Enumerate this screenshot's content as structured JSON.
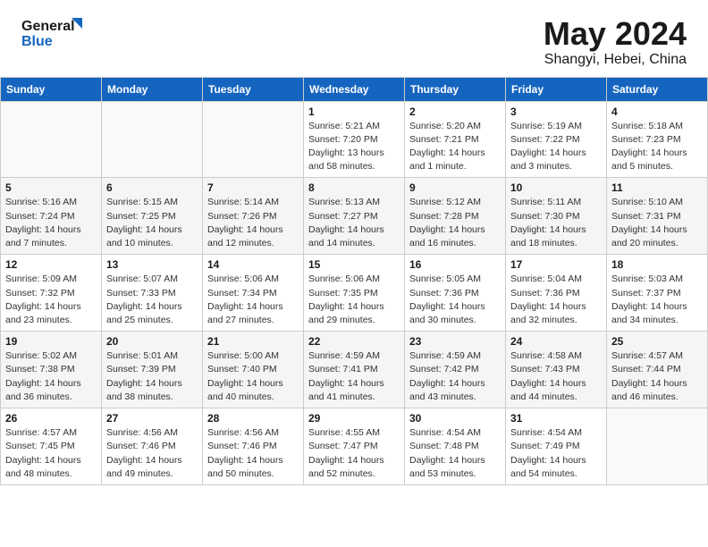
{
  "header": {
    "logo_line1": "General",
    "logo_line2": "Blue",
    "title": "May 2024",
    "subtitle": "Shangyi, Hebei, China"
  },
  "calendar": {
    "days_of_week": [
      "Sunday",
      "Monday",
      "Tuesday",
      "Wednesday",
      "Thursday",
      "Friday",
      "Saturday"
    ],
    "weeks": [
      [
        {
          "day": "",
          "info": ""
        },
        {
          "day": "",
          "info": ""
        },
        {
          "day": "",
          "info": ""
        },
        {
          "day": "1",
          "info": "Sunrise: 5:21 AM\nSunset: 7:20 PM\nDaylight: 13 hours\nand 58 minutes."
        },
        {
          "day": "2",
          "info": "Sunrise: 5:20 AM\nSunset: 7:21 PM\nDaylight: 14 hours\nand 1 minute."
        },
        {
          "day": "3",
          "info": "Sunrise: 5:19 AM\nSunset: 7:22 PM\nDaylight: 14 hours\nand 3 minutes."
        },
        {
          "day": "4",
          "info": "Sunrise: 5:18 AM\nSunset: 7:23 PM\nDaylight: 14 hours\nand 5 minutes."
        }
      ],
      [
        {
          "day": "5",
          "info": "Sunrise: 5:16 AM\nSunset: 7:24 PM\nDaylight: 14 hours\nand 7 minutes."
        },
        {
          "day": "6",
          "info": "Sunrise: 5:15 AM\nSunset: 7:25 PM\nDaylight: 14 hours\nand 10 minutes."
        },
        {
          "day": "7",
          "info": "Sunrise: 5:14 AM\nSunset: 7:26 PM\nDaylight: 14 hours\nand 12 minutes."
        },
        {
          "day": "8",
          "info": "Sunrise: 5:13 AM\nSunset: 7:27 PM\nDaylight: 14 hours\nand 14 minutes."
        },
        {
          "day": "9",
          "info": "Sunrise: 5:12 AM\nSunset: 7:28 PM\nDaylight: 14 hours\nand 16 minutes."
        },
        {
          "day": "10",
          "info": "Sunrise: 5:11 AM\nSunset: 7:30 PM\nDaylight: 14 hours\nand 18 minutes."
        },
        {
          "day": "11",
          "info": "Sunrise: 5:10 AM\nSunset: 7:31 PM\nDaylight: 14 hours\nand 20 minutes."
        }
      ],
      [
        {
          "day": "12",
          "info": "Sunrise: 5:09 AM\nSunset: 7:32 PM\nDaylight: 14 hours\nand 23 minutes."
        },
        {
          "day": "13",
          "info": "Sunrise: 5:07 AM\nSunset: 7:33 PM\nDaylight: 14 hours\nand 25 minutes."
        },
        {
          "day": "14",
          "info": "Sunrise: 5:06 AM\nSunset: 7:34 PM\nDaylight: 14 hours\nand 27 minutes."
        },
        {
          "day": "15",
          "info": "Sunrise: 5:06 AM\nSunset: 7:35 PM\nDaylight: 14 hours\nand 29 minutes."
        },
        {
          "day": "16",
          "info": "Sunrise: 5:05 AM\nSunset: 7:36 PM\nDaylight: 14 hours\nand 30 minutes."
        },
        {
          "day": "17",
          "info": "Sunrise: 5:04 AM\nSunset: 7:36 PM\nDaylight: 14 hours\nand 32 minutes."
        },
        {
          "day": "18",
          "info": "Sunrise: 5:03 AM\nSunset: 7:37 PM\nDaylight: 14 hours\nand 34 minutes."
        }
      ],
      [
        {
          "day": "19",
          "info": "Sunrise: 5:02 AM\nSunset: 7:38 PM\nDaylight: 14 hours\nand 36 minutes."
        },
        {
          "day": "20",
          "info": "Sunrise: 5:01 AM\nSunset: 7:39 PM\nDaylight: 14 hours\nand 38 minutes."
        },
        {
          "day": "21",
          "info": "Sunrise: 5:00 AM\nSunset: 7:40 PM\nDaylight: 14 hours\nand 40 minutes."
        },
        {
          "day": "22",
          "info": "Sunrise: 4:59 AM\nSunset: 7:41 PM\nDaylight: 14 hours\nand 41 minutes."
        },
        {
          "day": "23",
          "info": "Sunrise: 4:59 AM\nSunset: 7:42 PM\nDaylight: 14 hours\nand 43 minutes."
        },
        {
          "day": "24",
          "info": "Sunrise: 4:58 AM\nSunset: 7:43 PM\nDaylight: 14 hours\nand 44 minutes."
        },
        {
          "day": "25",
          "info": "Sunrise: 4:57 AM\nSunset: 7:44 PM\nDaylight: 14 hours\nand 46 minutes."
        }
      ],
      [
        {
          "day": "26",
          "info": "Sunrise: 4:57 AM\nSunset: 7:45 PM\nDaylight: 14 hours\nand 48 minutes."
        },
        {
          "day": "27",
          "info": "Sunrise: 4:56 AM\nSunset: 7:46 PM\nDaylight: 14 hours\nand 49 minutes."
        },
        {
          "day": "28",
          "info": "Sunrise: 4:56 AM\nSunset: 7:46 PM\nDaylight: 14 hours\nand 50 minutes."
        },
        {
          "day": "29",
          "info": "Sunrise: 4:55 AM\nSunset: 7:47 PM\nDaylight: 14 hours\nand 52 minutes."
        },
        {
          "day": "30",
          "info": "Sunrise: 4:54 AM\nSunset: 7:48 PM\nDaylight: 14 hours\nand 53 minutes."
        },
        {
          "day": "31",
          "info": "Sunrise: 4:54 AM\nSunset: 7:49 PM\nDaylight: 14 hours\nand 54 minutes."
        },
        {
          "day": "",
          "info": ""
        }
      ]
    ]
  }
}
